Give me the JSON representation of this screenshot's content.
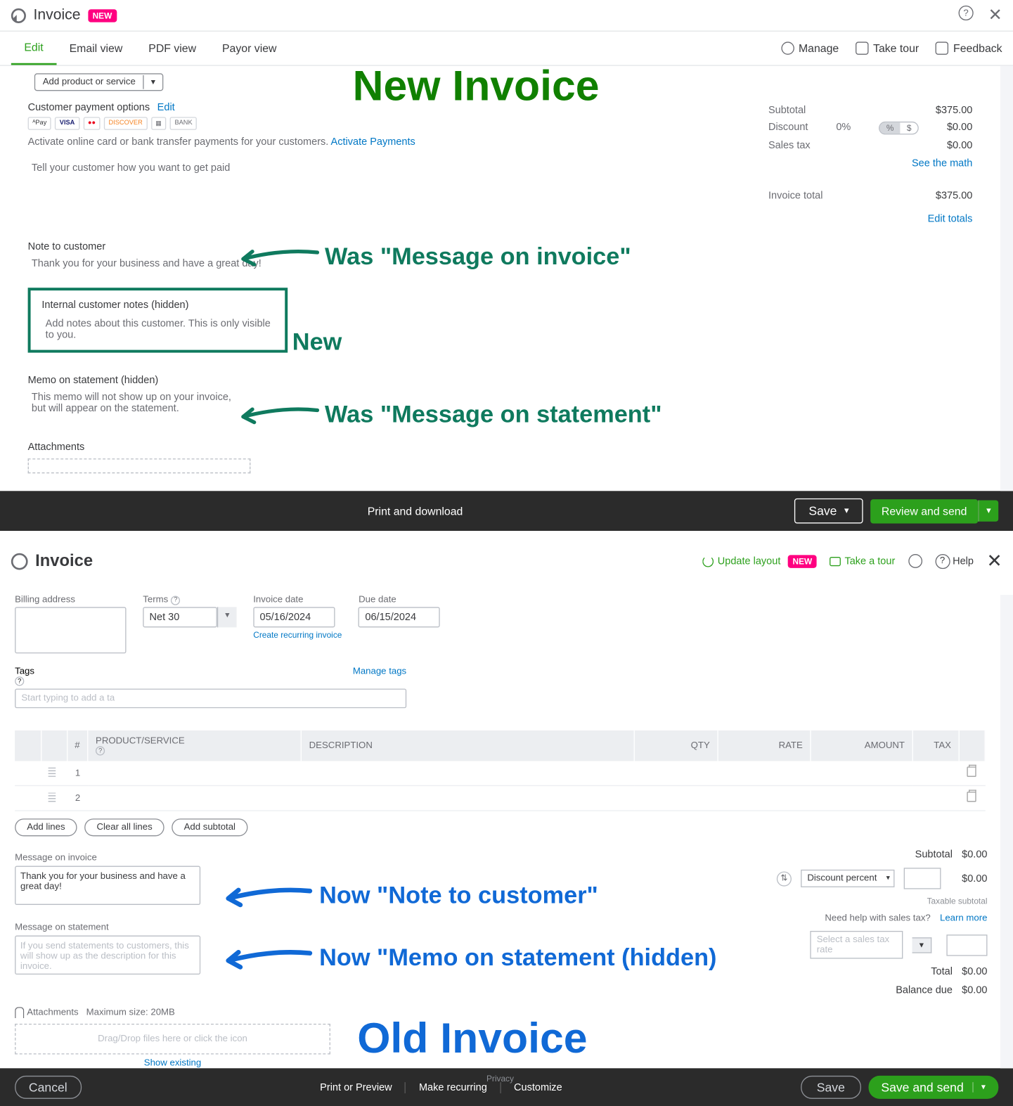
{
  "new": {
    "header": {
      "title": "Invoice",
      "badge": "NEW"
    },
    "tabs": [
      "Edit",
      "Email view",
      "PDF view",
      "Payor view"
    ],
    "tabsRight": {
      "manage": "Manage",
      "tour": "Take tour",
      "feedback": "Feedback"
    },
    "addProduct": "Add product or service",
    "bigTitle": "New Invoice",
    "cpo": {
      "title": "Customer payment options",
      "edit": "Edit",
      "methods": [
        "ᴬPay",
        "VISA",
        "●●",
        "DISCOVER",
        "▦",
        "BANK"
      ],
      "text": "Activate online card or bank transfer payments for your customers. ",
      "activate": "Activate Payments",
      "tell": "Tell your customer how you want to get paid"
    },
    "totals": {
      "subtotal": {
        "label": "Subtotal",
        "value": "$375.00"
      },
      "discount": {
        "label": "Discount",
        "pct": "0%",
        "toggle": [
          "%",
          "$"
        ],
        "value": "$0.00"
      },
      "tax": {
        "label": "Sales tax",
        "value": "$0.00"
      },
      "seeMath": "See the math",
      "invoiceTotal": {
        "label": "Invoice total",
        "value": "$375.00"
      },
      "editTotals": "Edit totals"
    },
    "note": {
      "label": "Note to customer",
      "text": "Thank you for your business and have a great day!"
    },
    "internal": {
      "label": "Internal customer notes (hidden)",
      "text": "Add notes about this customer. This is only visible to you."
    },
    "memo": {
      "label": "Memo on statement (hidden)",
      "text": "This memo will not show up on your invoice, but will appear on the statement."
    },
    "attachments": "Attachments",
    "annotations": {
      "note": "Was \"Message on invoice\"",
      "internal": "New",
      "memo": "Was \"Message on statement\""
    },
    "footer": {
      "print": "Print and download",
      "save": "Save",
      "review": "Review and send"
    }
  },
  "old": {
    "header": {
      "title": "Invoice",
      "update": "Update layout",
      "badge": "NEW",
      "tour": "Take a tour",
      "help": "Help"
    },
    "fields": {
      "billing": "Billing address",
      "terms": {
        "label": "Terms",
        "value": "Net 30"
      },
      "invDate": {
        "label": "Invoice date",
        "value": "05/16/2024"
      },
      "dueDate": {
        "label": "Due date",
        "value": "06/15/2024"
      },
      "createRecurring": "Create recurring invoice",
      "tags": {
        "label": "Tags",
        "manage": "Manage tags",
        "placeholder": "Start typing to add a ta"
      }
    },
    "table": {
      "cols": [
        "#",
        "PRODUCT/SERVICE",
        "DESCRIPTION",
        "QTY",
        "RATE",
        "AMOUNT",
        "TAX"
      ],
      "rows": [
        {
          "n": "1"
        },
        {
          "n": "2"
        }
      ]
    },
    "lineBtns": [
      "Add lines",
      "Clear all lines",
      "Add subtotal"
    ],
    "totals": {
      "subtotal": {
        "label": "Subtotal",
        "value": "$0.00"
      },
      "discount": {
        "select": "Discount percent",
        "value": "$0.00"
      },
      "taxable": "Taxable subtotal",
      "taxHelp": "Need help with sales tax? ",
      "learn": "Learn more",
      "taxSelect": "Select a sales tax rate",
      "total": {
        "label": "Total",
        "value": "$0.00"
      },
      "balance": {
        "label": "Balance due",
        "value": "$0.00"
      }
    },
    "msgInv": {
      "label": "Message on invoice",
      "text": "Thank you for your business and have a great day!"
    },
    "msgStmt": {
      "label": "Message on statement",
      "text": "If you send statements to customers, this will show up as the description for this invoice."
    },
    "attach": {
      "label": "Attachments",
      "max": "Maximum size: 20MB",
      "drop": "Drag/Drop files here or click the icon",
      "show": "Show existing"
    },
    "privacy": "Privacy",
    "bigTitle": "Old Invoice",
    "annotations": {
      "inv": "Now \"Note to customer\"",
      "stmt": "Now \"Memo on statement (hidden)"
    },
    "footer": {
      "cancel": "Cancel",
      "print": "Print or Preview",
      "recurring": "Make recurring",
      "customize": "Customize",
      "save": "Save",
      "saveSend": "Save and send"
    }
  }
}
